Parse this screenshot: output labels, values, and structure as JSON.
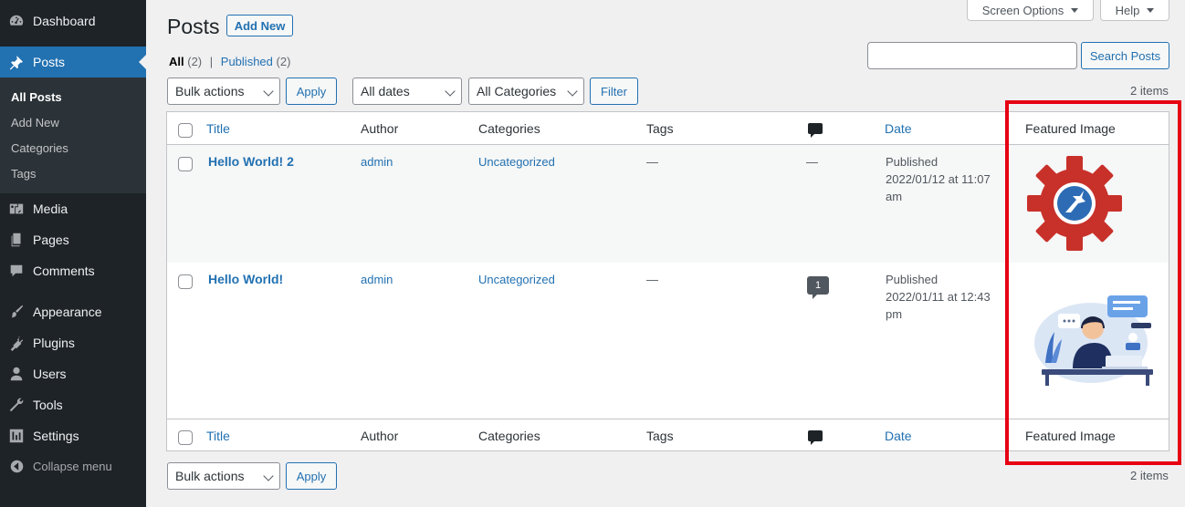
{
  "sidebar": {
    "dashboard": "Dashboard",
    "posts": "Posts",
    "posts_sub": [
      "All Posts",
      "Add New",
      "Categories",
      "Tags"
    ],
    "media": "Media",
    "pages": "Pages",
    "comments": "Comments",
    "appearance": "Appearance",
    "plugins": "Plugins",
    "users": "Users",
    "tools": "Tools",
    "settings": "Settings",
    "collapse": "Collapse menu"
  },
  "top": {
    "screen_options": "Screen Options",
    "help": "Help"
  },
  "header": {
    "title": "Posts",
    "add_new": "Add New"
  },
  "views": {
    "all": "All",
    "all_count": "(2)",
    "sep": "|",
    "published": "Published",
    "published_count": "(2)"
  },
  "search": {
    "button": "Search Posts",
    "value": ""
  },
  "filters": {
    "bulk_actions": "Bulk actions",
    "apply": "Apply",
    "all_dates": "All dates",
    "all_categories": "All Categories",
    "filter": "Filter",
    "items_count": "2 items"
  },
  "table": {
    "columns": [
      "Title",
      "Author",
      "Categories",
      "Tags",
      "",
      "Date",
      "Featured Image"
    ],
    "rows": [
      {
        "title": "Hello World! 2",
        "author": "admin",
        "categories": "Uncategorized",
        "tags": "—",
        "comments": "—",
        "date_status": "Published",
        "date_line1": "2022/01/12 at 11:07",
        "date_line2": "am",
        "image": "gear-logo-icon"
      },
      {
        "title": "Hello World!",
        "author": "admin",
        "categories": "Uncategorized",
        "tags": "—",
        "comments": "1",
        "date_status": "Published",
        "date_line1": "2022/01/11 at 12:43",
        "date_line2": "pm",
        "image": "support-agent-illustration"
      }
    ]
  },
  "colors": {
    "sidebar_bg": "#1d2327",
    "active": "#2271b1",
    "link": "#2271b1",
    "highlight": "#e60012",
    "gear": "#c8312a"
  }
}
